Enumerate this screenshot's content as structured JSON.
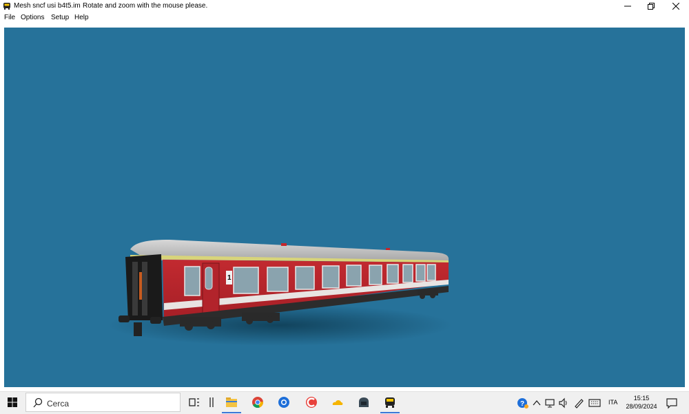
{
  "window": {
    "title": "Mesh sncf usi b4t5.im",
    "hint": "Rotate and zoom with the mouse please.",
    "controls": [
      "minimize-icon",
      "restore-icon",
      "close-icon"
    ]
  },
  "menu": {
    "file": "File",
    "options": "Options",
    "setup": "Setup",
    "help": "Help"
  },
  "viewport": {
    "background_color": "#26729a",
    "model": "red passenger coach",
    "coach_class_mark": "1"
  },
  "taskbar": {
    "search_placeholder": "Cerca",
    "pinned_apps": [
      "task-view-icon",
      "file-explorer-icon",
      "chrome-icon",
      "app-blue-icon",
      "ccleaner-icon",
      "onedrive-icon",
      "steam-icon",
      "train-sim-icon"
    ],
    "tray": {
      "language": "ITA",
      "time": "15:15",
      "date": "28/09/2024"
    }
  }
}
